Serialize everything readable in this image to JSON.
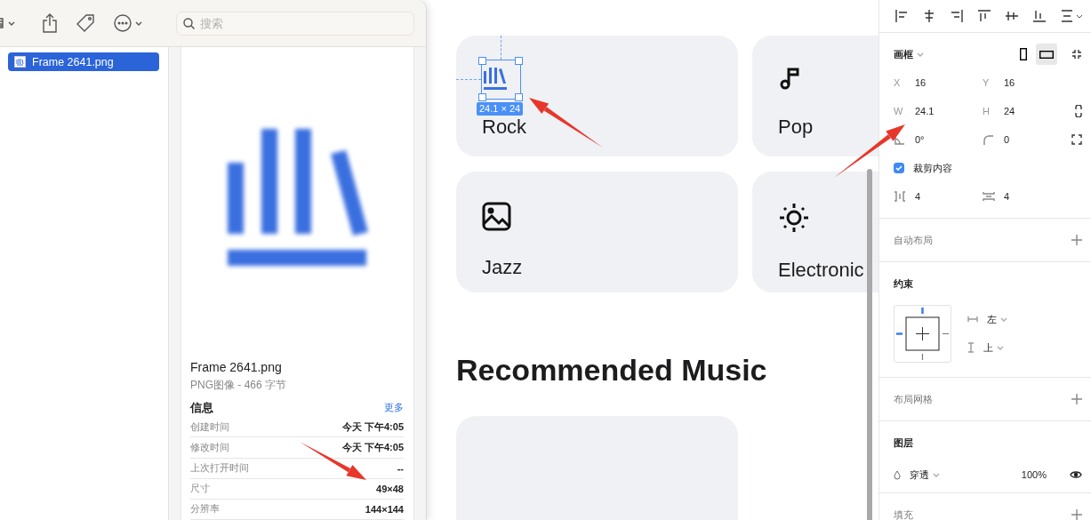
{
  "finder": {
    "search": {
      "placeholder": "搜索"
    },
    "sidebar": {
      "items": [
        {
          "label": "Frame 2641.png",
          "selected": true
        }
      ]
    },
    "preview": {
      "name": "Frame 2641.png",
      "kind": "PNG图像 - 466 字节",
      "info_title": "信息",
      "more_link": "更多",
      "rows": [
        {
          "label": "创建时间",
          "value": "今天 下午4:05"
        },
        {
          "label": "修改时间",
          "value": "今天 下午4:05"
        },
        {
          "label": "上次打开时间",
          "value": "--"
        },
        {
          "label": "尺寸",
          "value": "49×48"
        },
        {
          "label": "分辨率",
          "value": "144×144"
        }
      ]
    }
  },
  "canvas": {
    "categories": [
      {
        "label": "Rock",
        "kind": "chart"
      },
      {
        "label": "Pop",
        "kind": "note"
      },
      {
        "label": "Jazz",
        "kind": "image"
      },
      {
        "label": "Electronic",
        "kind": "sun"
      }
    ],
    "selection_badge": "24.1 × 24",
    "heading": "Recommended Music"
  },
  "inspector": {
    "frame": {
      "label": "画框",
      "orientations": [
        {
          "kind": "portrait",
          "selected": false
        },
        {
          "kind": "landscape",
          "selected": true
        }
      ]
    },
    "fields": [
      {
        "kind": "letter",
        "label": "X",
        "value": "16"
      },
      {
        "kind": "letter",
        "label": "Y",
        "value": "16"
      },
      {
        "kind": "letter",
        "label": "W",
        "value": "24.1"
      },
      {
        "kind": "letter",
        "label": "H",
        "value": "24"
      },
      {
        "kind": "rotation",
        "value": "0°"
      },
      {
        "kind": "radius",
        "value": "0"
      }
    ],
    "clip": {
      "label": "裁剪内容",
      "checked": true
    },
    "spacing": [
      {
        "kind": "horizontal",
        "value": "4"
      },
      {
        "kind": "vertical",
        "value": "4"
      }
    ],
    "auto_layout": {
      "title": "自动布局"
    },
    "constraints": {
      "title": "约束",
      "horizontal": "左",
      "vertical": "上"
    },
    "layout_grid": {
      "title": "布局网格"
    },
    "layer": {
      "title": "图层",
      "blend": "穿透",
      "opacity": "100%"
    },
    "fill": {
      "title": "填充"
    }
  }
}
